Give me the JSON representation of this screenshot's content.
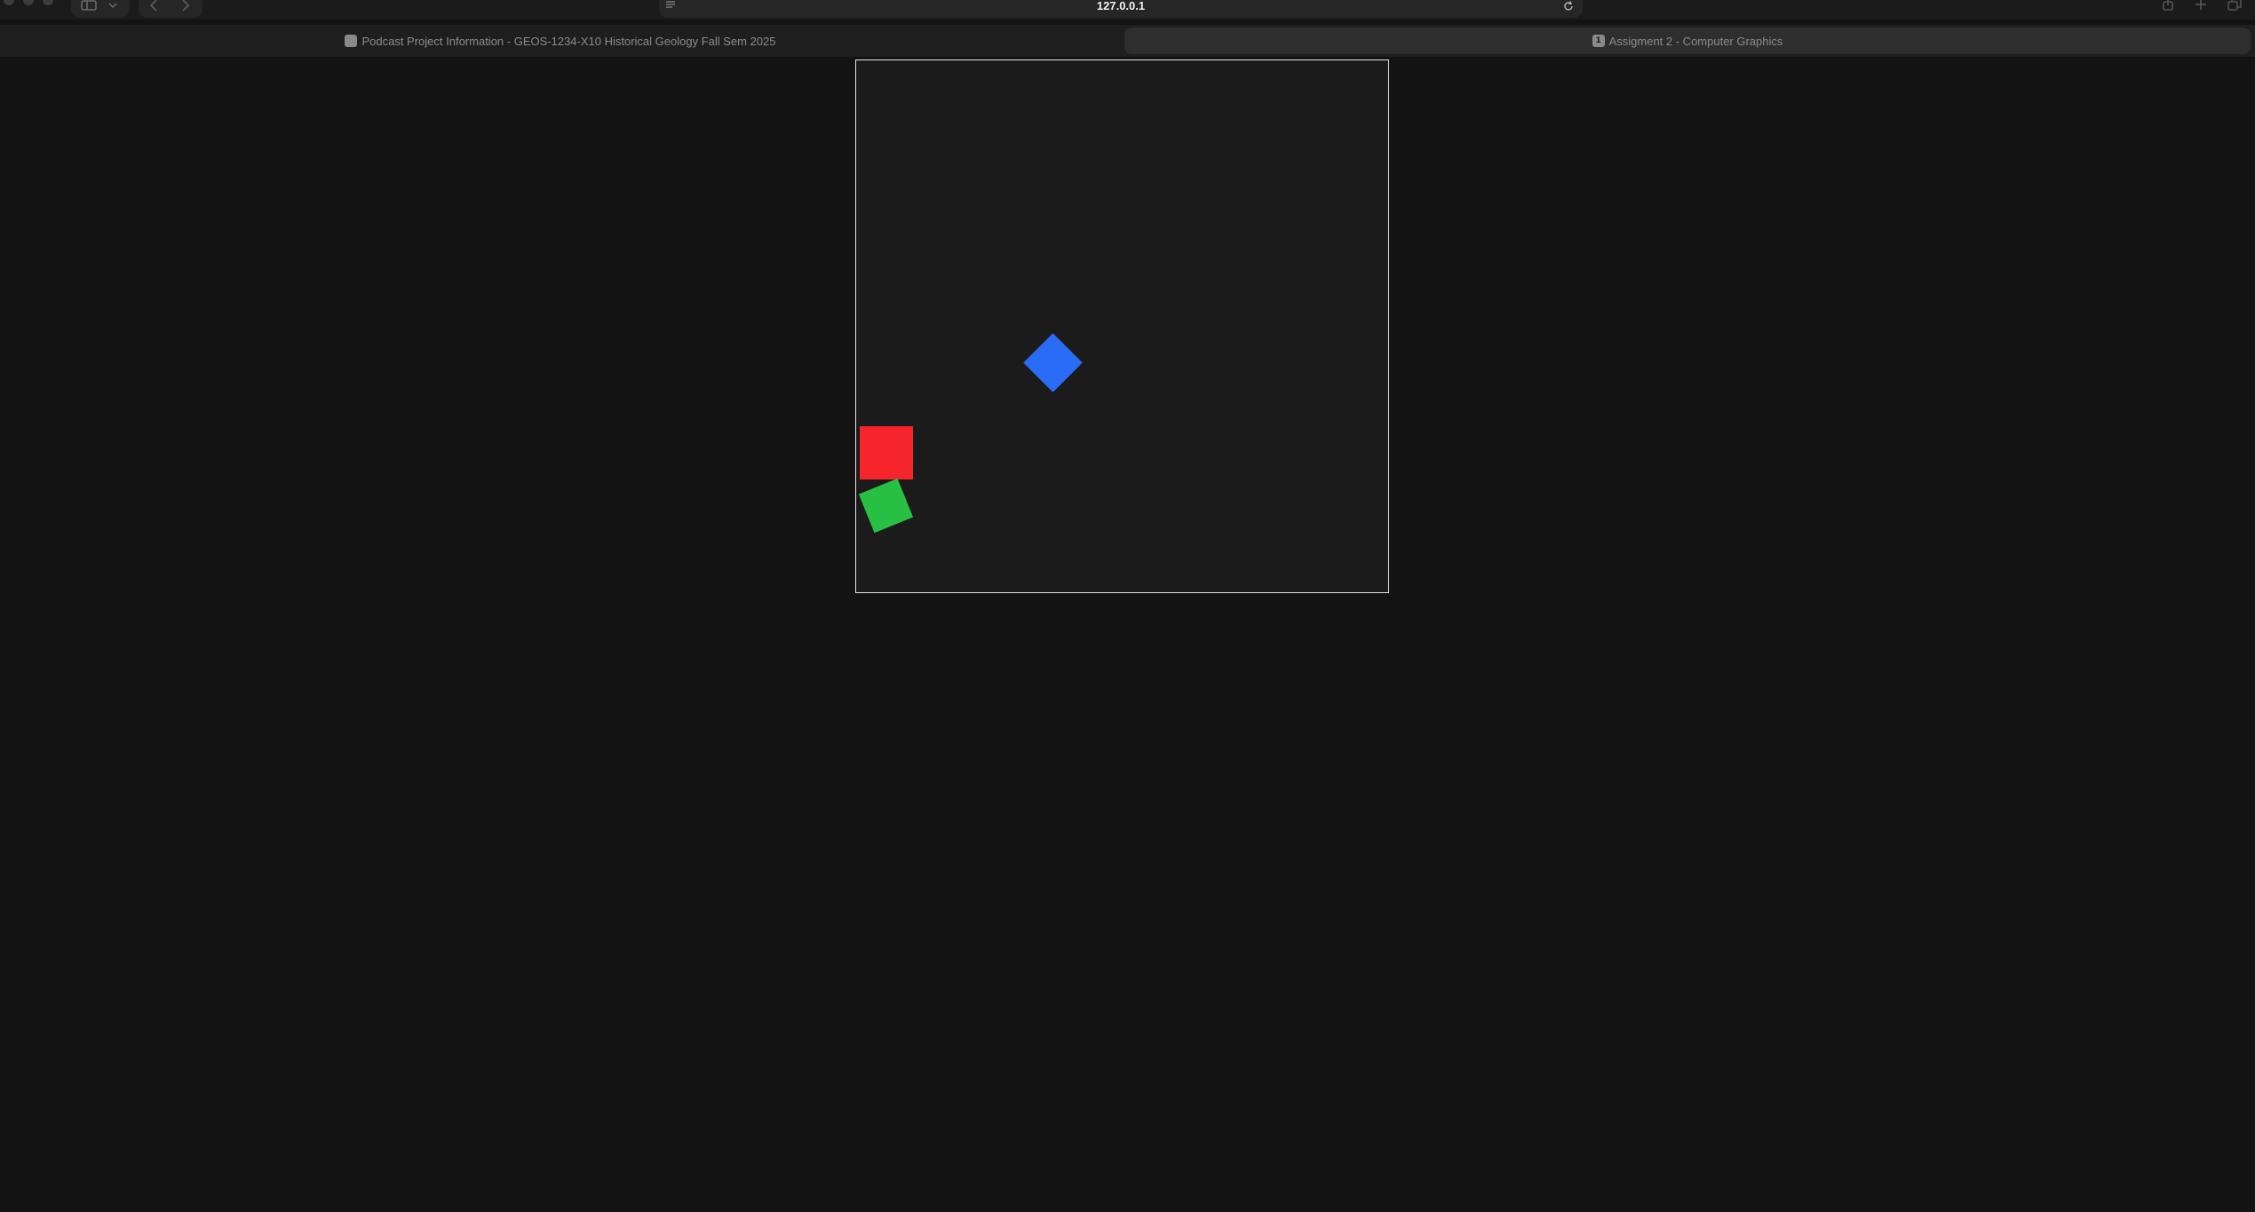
{
  "browser": {
    "url": "127.0.0.1",
    "tabs": [
      {
        "title": "Podcast Project Information - GEOS-1234-X10 Historical Geology Fall Sem 2025",
        "favicon_label": "",
        "active": false
      },
      {
        "title": "Assigment 2 - Computer Graphics",
        "favicon_label": "1",
        "active": true
      }
    ]
  },
  "canvas": {
    "background": "#1b1b1b",
    "border_color": "#e6e6e6",
    "shapes": [
      {
        "name": "blue-square",
        "color": "#2a6cf5"
      },
      {
        "name": "red-square",
        "color": "#f5252b"
      },
      {
        "name": "green-square",
        "color": "#28c043"
      }
    ]
  }
}
